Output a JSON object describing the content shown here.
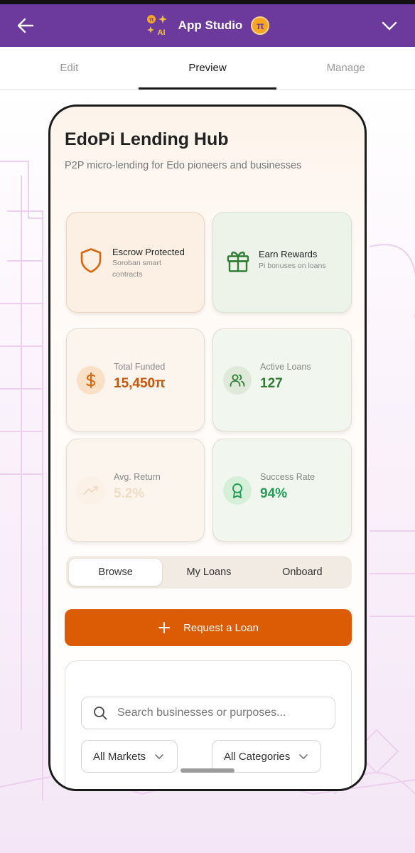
{
  "header": {
    "title": "App Studio",
    "ai_badge": "AI",
    "back_icon": "arrow-left-icon",
    "menu_icon": "chevron-down-icon",
    "coin_symbol": "π",
    "color": "#6c3a9c"
  },
  "tabs": [
    {
      "label": "Edit",
      "active": false
    },
    {
      "label": "Preview",
      "active": true
    },
    {
      "label": "Manage",
      "active": false
    }
  ],
  "app": {
    "name": "EdoPi Lending Hub",
    "subtitle": "P2P micro-lending for Edo pioneers and businesses",
    "features": [
      {
        "title": "Escrow Protected",
        "subtitle": "Soroban smart contracts",
        "icon": "shield-icon"
      },
      {
        "title": "Earn Rewards",
        "subtitle": "Pi bonuses on loans",
        "icon": "gift-icon"
      }
    ],
    "stats": [
      {
        "label": "Total Funded",
        "value": "15,450π",
        "icon": "dollar-icon"
      },
      {
        "label": "Active Loans",
        "value": "127",
        "icon": "users-icon"
      },
      {
        "label": "Avg. Return",
        "value": "5.2%",
        "icon": "trending-up-icon"
      },
      {
        "label": "Success Rate",
        "value": "94%",
        "icon": "award-icon"
      }
    ],
    "segments": [
      {
        "label": "Browse",
        "active": true
      },
      {
        "label": "My Loans",
        "active": false
      },
      {
        "label": "Onboard",
        "active": false
      }
    ],
    "request_button": "Request a Loan",
    "search_placeholder": "Search businesses or purposes...",
    "filters": {
      "market": "All Markets",
      "category": "All Categories"
    },
    "colors": {
      "accent_orange": "#dc5c05",
      "accent_green": "#2e7d32",
      "success_green": "#1f9d55"
    }
  }
}
